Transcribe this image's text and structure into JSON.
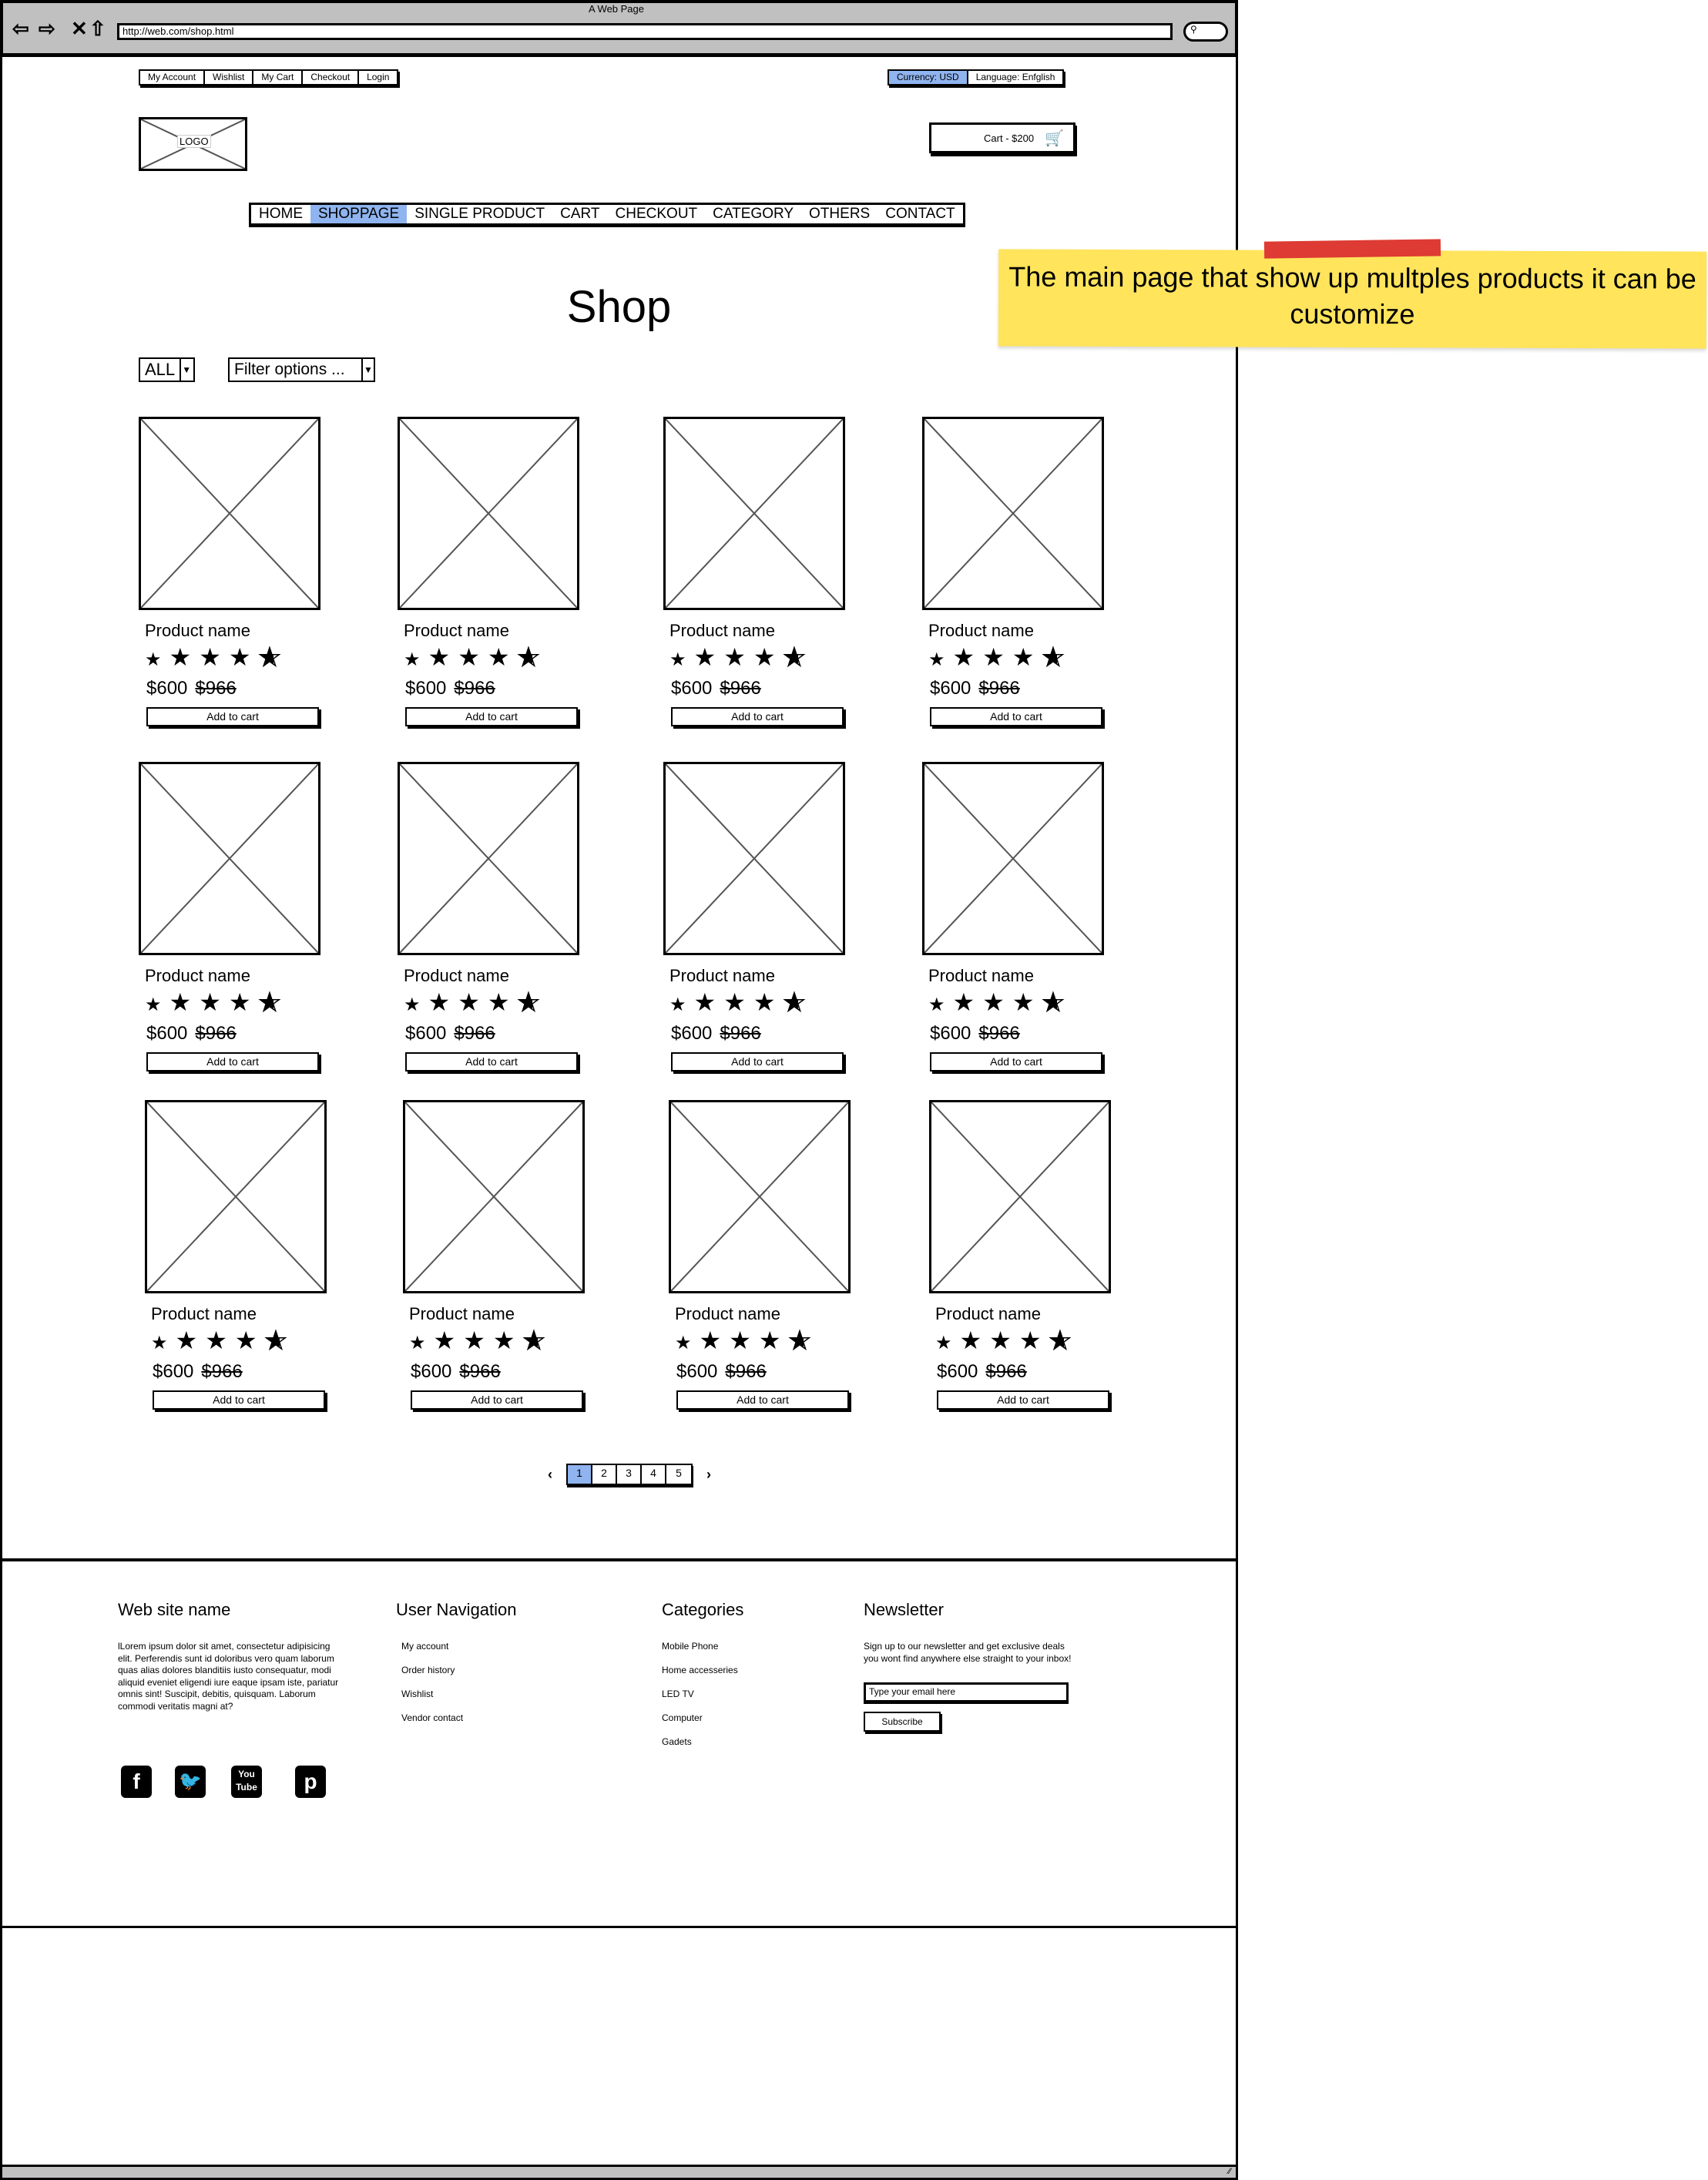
{
  "browser": {
    "title": "A Web Page",
    "url": "http://web.com/shop.html",
    "search_icon": "search-icon"
  },
  "top_links": [
    "My Account",
    "Wishlist",
    "My Cart",
    "Checkout",
    "Login"
  ],
  "locale": {
    "currency": "Currency: USD",
    "language": "Language: Enfglish"
  },
  "logo": "LOGO",
  "cart": {
    "label": "Cart - $200"
  },
  "nav": {
    "items": [
      "HOME",
      "SHOPPAGE",
      "SINGLE PRODUCT",
      "CART",
      "CHECKOUT",
      "CATEGORY",
      "OTHERS",
      "CONTACT"
    ],
    "active": 1
  },
  "page_title": "Shop",
  "filters": {
    "category": "ALL",
    "options": "Filter options ..."
  },
  "products": [
    {
      "name": "Product name",
      "rating": 4.5,
      "price": "$600",
      "old_price": "$966",
      "button": "Add to cart"
    },
    {
      "name": "Product name",
      "rating": 4.5,
      "price": "$600",
      "old_price": "$966",
      "button": "Add to cart"
    },
    {
      "name": "Product name",
      "rating": 4.5,
      "price": "$600",
      "old_price": "$966",
      "button": "Add to cart"
    },
    {
      "name": "Product name",
      "rating": 4.5,
      "price": "$600",
      "old_price": "$966",
      "button": "Add to cart"
    },
    {
      "name": "Product name",
      "rating": 4.5,
      "price": "$600",
      "old_price": "$966",
      "button": "Add to cart"
    },
    {
      "name": "Product name",
      "rating": 4.5,
      "price": "$600",
      "old_price": "$966",
      "button": "Add to cart"
    },
    {
      "name": "Product name",
      "rating": 4.5,
      "price": "$600",
      "old_price": "$966",
      "button": "Add to cart"
    },
    {
      "name": "Product name",
      "rating": 4.5,
      "price": "$600",
      "old_price": "$966",
      "button": "Add to cart"
    },
    {
      "name": "Product name",
      "rating": 4.5,
      "price": "$600",
      "old_price": "$966",
      "button": "Add to cart"
    },
    {
      "name": "Product name",
      "rating": 4.5,
      "price": "$600",
      "old_price": "$966",
      "button": "Add to cart"
    },
    {
      "name": "Product name",
      "rating": 4.5,
      "price": "$600",
      "old_price": "$966",
      "button": "Add to cart"
    },
    {
      "name": "Product name",
      "rating": 4.5,
      "price": "$600",
      "old_price": "$966",
      "button": "Add to cart"
    }
  ],
  "pagination": {
    "prev": "‹",
    "next": "›",
    "pages": [
      "1",
      "2",
      "3",
      "4",
      "5"
    ],
    "current": "1"
  },
  "footer": {
    "site": {
      "title": "Web site name",
      "text": "lLorem ipsum dolor sit amet, consectetur adipisicing elit. Perferendis sunt id doloribus vero quam laborum quas alias dolores blanditiis iusto consequatur, modi aliquid eveniet eligendi iure eaque ipsam iste, pariatur omnis sint! Suscipit, debitis, quisquam. Laborum commodi veritatis magni at?"
    },
    "user_nav": {
      "title": "User Navigation",
      "items": [
        "My account",
        "Order history",
        "Wishlist",
        "Vendor contact"
      ]
    },
    "categories": {
      "title": "Categories",
      "items": [
        "Mobile Phone",
        "Home accesseries",
        "LED TV",
        "Computer",
        "Gadets"
      ]
    },
    "newsletter": {
      "title": "Newsletter",
      "text": "Sign up to our newsletter and get exclusive deals you wont find anywhere else straight to your inbox!",
      "placeholder": "Type your email here",
      "button": "Subscribe"
    },
    "social": [
      "facebook-icon",
      "twitter-icon",
      "youtube-icon",
      "pinterest-icon"
    ]
  },
  "annotation": {
    "text": "The main page that show up multples products it can be customize",
    "color": "#ffe45c",
    "tape_color": "#dd3b33"
  },
  "colors": {
    "highlight": "#8fb4ef",
    "chrome": "#c0c0c0"
  }
}
